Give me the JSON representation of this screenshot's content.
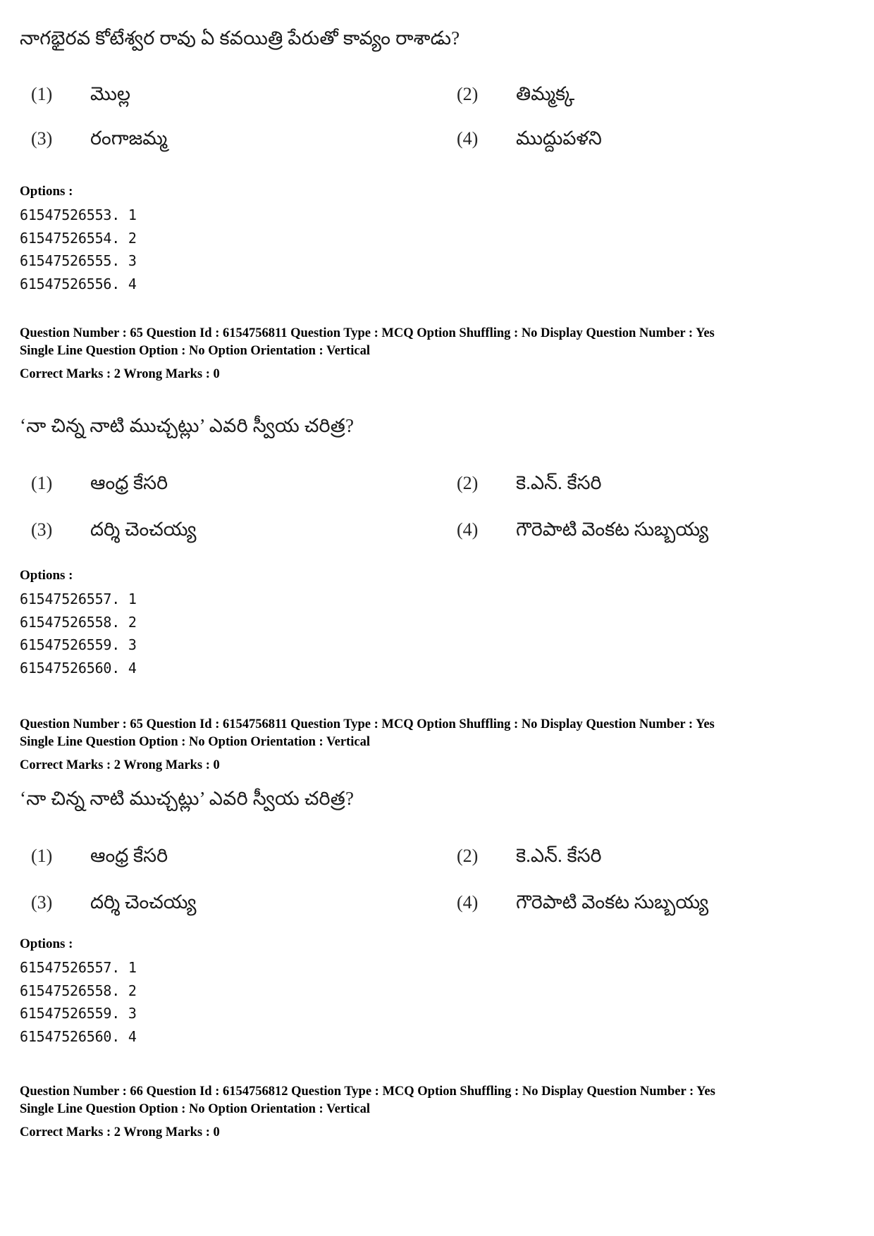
{
  "page": {
    "background_color": "#ffffff",
    "text_color": "#000000"
  },
  "blocks": [
    {
      "question_text": "నాగభైరవ కోటేశ్వర రావు ఏ కవయిత్రి పేరుతో కావ్యం రాశాడు?",
      "options": [
        {
          "num": "(1)",
          "text": "మొల్ల"
        },
        {
          "num": "(2)",
          "text": "తిమ్మక్క"
        },
        {
          "num": "(3)",
          "text": "రంగాజమ్మ"
        },
        {
          "num": "(4)",
          "text": "ముద్దుపళని"
        }
      ],
      "options_label": "Options :",
      "option_ids": [
        "61547526553. 1",
        "61547526554. 2",
        "61547526555. 3",
        "61547526556. 4"
      ],
      "meta_line1": "Question Number : 65  Question Id : 6154756811  Question Type : MCQ  Option Shuffling : No  Display Question Number : Yes",
      "meta_line2": "Single Line Question Option : No  Option Orientation : Vertical",
      "meta_marks": "Correct Marks : 2  Wrong Marks : 0"
    },
    {
      "question_text": "‘నా చిన్న నాటి ముచ్చట్లు’ ఎవరి స్వీయ చరిత్ర?",
      "options": [
        {
          "num": "(1)",
          "text": "ఆంధ్ర కేసరి"
        },
        {
          "num": "(2)",
          "text": "కె.ఎన్. కేసరి"
        },
        {
          "num": "(3)",
          "text": "దర్శి చెంచయ్య"
        },
        {
          "num": "(4)",
          "text": "గౌరెపాటి వెంకట సుబ్బయ్య"
        }
      ],
      "options_label": "Options :",
      "option_ids": [
        "61547526557. 1",
        "61547526558. 2",
        "61547526559. 3",
        "61547526560. 4"
      ],
      "meta_line1": "Question Number : 65  Question Id : 6154756811  Question Type : MCQ  Option Shuffling : No  Display Question Number : Yes",
      "meta_line2": "Single Line Question Option : No  Option Orientation : Vertical",
      "meta_marks": "Correct Marks : 2  Wrong Marks : 0"
    },
    {
      "question_text": "‘నా చిన్న నాటి ముచ్చట్లు’ ఎవరి స్వీయ చరిత్ర?",
      "options": [
        {
          "num": "(1)",
          "text": "ఆంధ్ర కేసరి"
        },
        {
          "num": "(2)",
          "text": "కె.ఎన్. కేసరి"
        },
        {
          "num": "(3)",
          "text": "దర్శి చెంచయ్య"
        },
        {
          "num": "(4)",
          "text": "గౌరెపాటి వెంకట సుబ్బయ్య"
        }
      ],
      "options_label": "Options :",
      "option_ids": [
        "61547526557. 1",
        "61547526558. 2",
        "61547526559. 3",
        "61547526560. 4"
      ],
      "meta_line1": "Question Number : 66  Question Id : 6154756812  Question Type : MCQ  Option Shuffling : No  Display Question Number : Yes",
      "meta_line2": "Single Line Question Option : No  Option Orientation : Vertical",
      "meta_marks": "Correct Marks : 2  Wrong Marks : 0"
    }
  ]
}
